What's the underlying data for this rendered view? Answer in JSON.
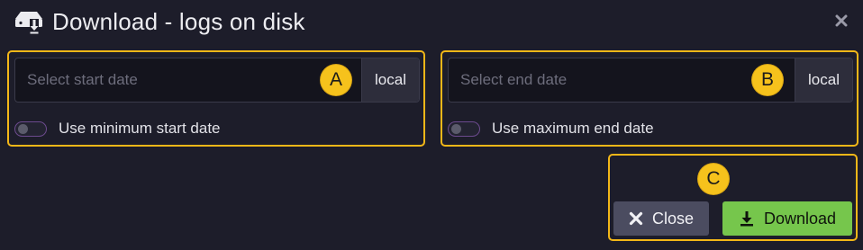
{
  "dialog": {
    "title": "Download - logs on disk",
    "title_icon": "download-disk-icon",
    "close_icon": "close-icon"
  },
  "start": {
    "placeholder": "Select start date",
    "value": "",
    "zone": "local",
    "toggle_label": "Use minimum start date",
    "toggle_on": false
  },
  "end": {
    "placeholder": "Select end date",
    "value": "",
    "zone": "local",
    "toggle_label": "Use maximum end date",
    "toggle_on": false
  },
  "annotations": {
    "a": "A",
    "b": "B",
    "c": "C"
  },
  "actions": {
    "close_label": "Close",
    "close_icon": "x-icon",
    "download_label": "Download",
    "download_icon": "download-icon"
  },
  "colors": {
    "background": "#1d1d2a",
    "annotation": "#f3b718",
    "download_button": "#76c64c",
    "close_button": "#4b4c60",
    "toggle_border": "#6c4a8e"
  }
}
